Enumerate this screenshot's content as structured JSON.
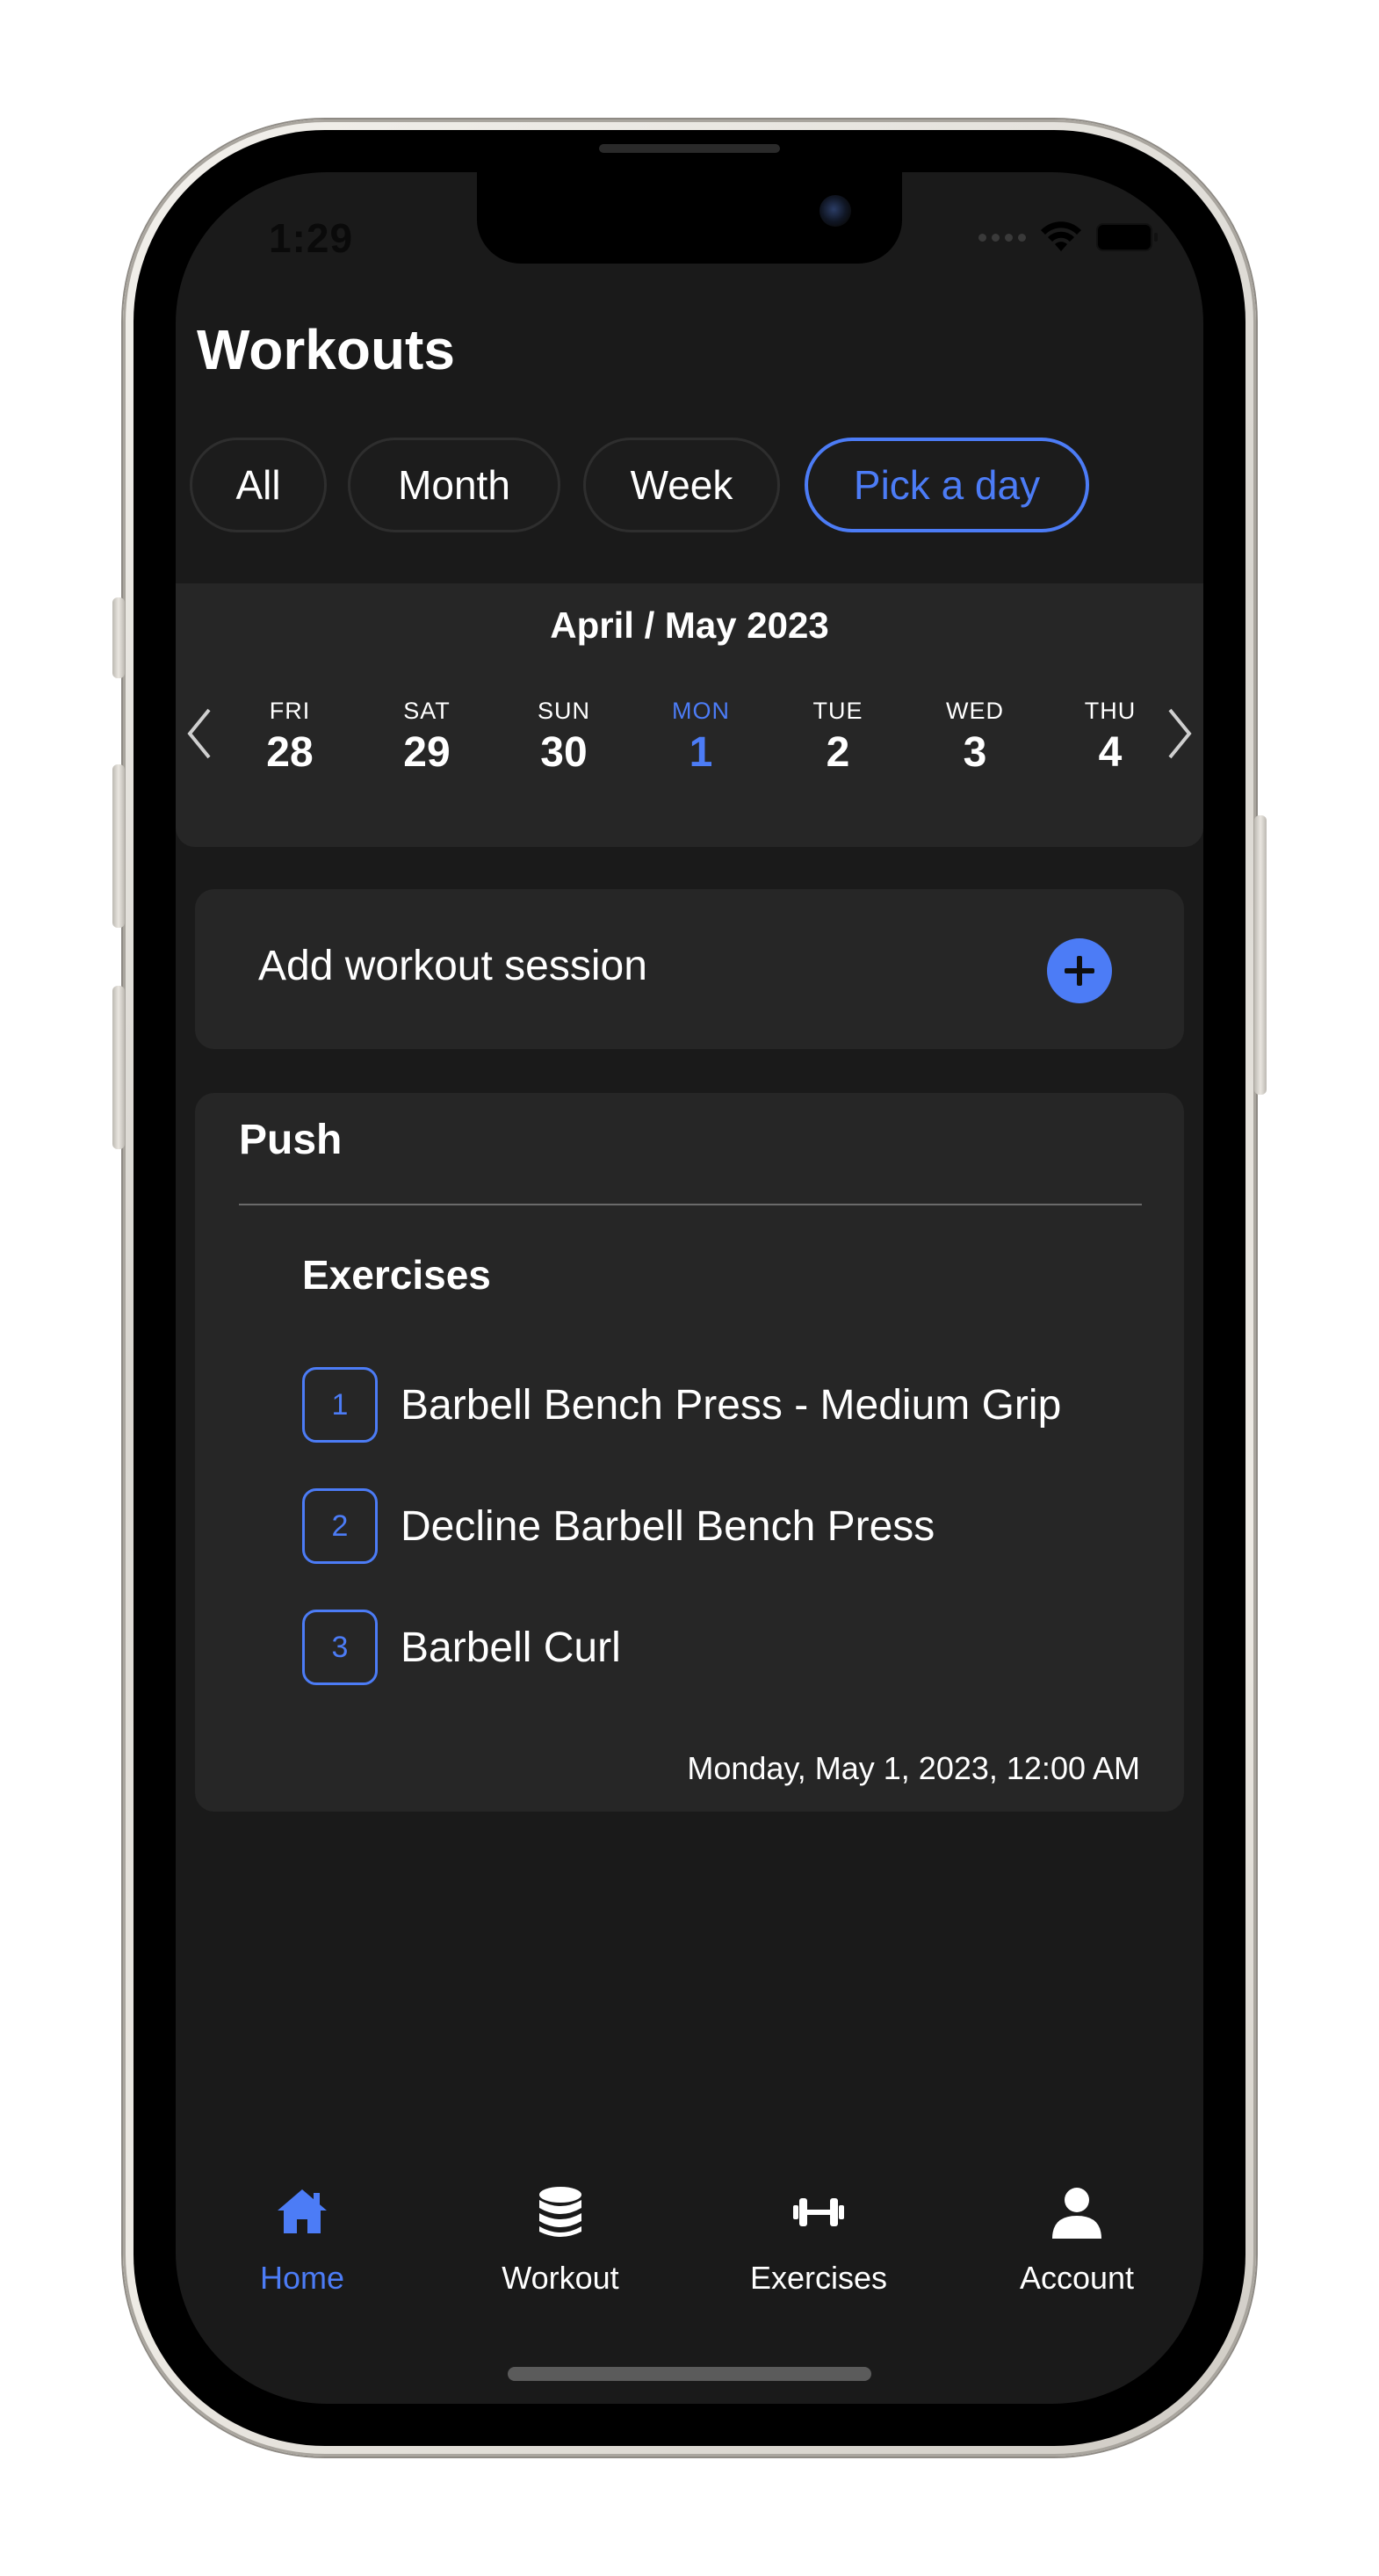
{
  "status_bar": {
    "time": "1:29"
  },
  "header": {
    "title": "Workouts"
  },
  "filters": [
    {
      "label": "All",
      "active": false
    },
    {
      "label": "Month",
      "active": false
    },
    {
      "label": "Week",
      "active": false
    },
    {
      "label": "Pick a day",
      "active": true
    }
  ],
  "calendar": {
    "title": "April / May 2023",
    "prev_icon": "chevron-left-icon",
    "next_icon": "chevron-right-icon",
    "days": [
      {
        "dow": "FRI",
        "num": "28",
        "selected": false
      },
      {
        "dow": "SAT",
        "num": "29",
        "selected": false
      },
      {
        "dow": "SUN",
        "num": "30",
        "selected": false
      },
      {
        "dow": "MON",
        "num": "1",
        "selected": true
      },
      {
        "dow": "TUE",
        "num": "2",
        "selected": false
      },
      {
        "dow": "WED",
        "num": "3",
        "selected": false
      },
      {
        "dow": "THU",
        "num": "4",
        "selected": false
      }
    ]
  },
  "add_session": {
    "label": "Add workout session",
    "icon": "plus-circle-icon"
  },
  "workout": {
    "name": "Push",
    "exercises_heading": "Exercises",
    "exercises": [
      {
        "index": "1",
        "name": "Barbell Bench Press - Medium Grip"
      },
      {
        "index": "2",
        "name": "Decline Barbell Bench Press"
      },
      {
        "index": "3",
        "name": "Barbell Curl"
      }
    ],
    "date": "Monday, May 1, 2023, 12:00 AM"
  },
  "tabbar": {
    "items": [
      {
        "label": "Home",
        "icon": "home-icon",
        "active": true
      },
      {
        "label": "Workout",
        "icon": "database-icon",
        "active": false
      },
      {
        "label": "Exercises",
        "icon": "dumbbell-icon",
        "active": false
      },
      {
        "label": "Account",
        "icon": "user-icon",
        "active": false
      }
    ]
  },
  "colors": {
    "accent": "#4c7cf6",
    "background": "#1a1a1a",
    "card": "#262626",
    "text": "#ffffff"
  }
}
